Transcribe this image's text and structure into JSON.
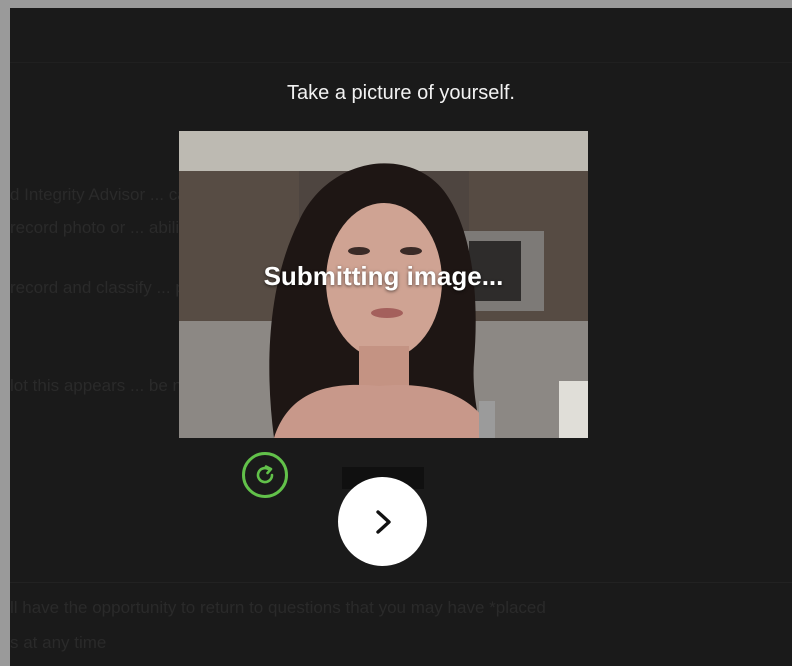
{
  "capture": {
    "title": "Take a picture of yourself.",
    "status": "Submitting image..."
  },
  "background_text": [
    "d Integrity Advisor ... camera/microphone and",
    "record photo or ... ability content.",
    "record and classify ... present your proctor",
    "lot this appears ... be not loaded at this",
    "ll have the opportunity to return to questions that you may have *placed",
    "s at any time"
  ],
  "controls": {
    "retake_icon": "refresh-icon",
    "next_icon": "chevron-right-icon"
  },
  "colors": {
    "background": "#1a1a1a",
    "accent": "#62c14a",
    "button": "#ffffff"
  }
}
